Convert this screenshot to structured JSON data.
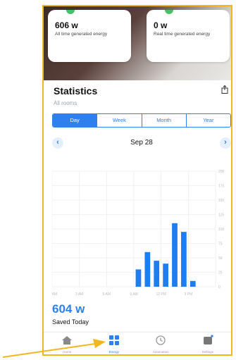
{
  "cards": [
    {
      "value": "606 w",
      "label": "All time generated energy"
    },
    {
      "value": "0 w",
      "label": "Real time generated energy"
    }
  ],
  "statistics": {
    "title": "Statistics",
    "rooms": "All rooms"
  },
  "segments": [
    "Day",
    "Week",
    "Month",
    "Year"
  ],
  "date": "Sep 28",
  "chart_data": {
    "type": "bar",
    "categories": [
      "12 AM",
      "3 AM",
      "6 AM",
      "9 AM",
      "12 PM",
      "3 PM",
      "6 PM"
    ],
    "x_tick_labels": [
      "12 AM",
      "3 AM",
      "6 AM",
      "9 AM",
      "12 PM",
      "3 PM"
    ],
    "values_by_hour": {
      "9": 30,
      "10": 60,
      "11": 45,
      "12": 40,
      "13": 110,
      "14": 95,
      "15": 10
    },
    "y_tick_labels": [
      "0",
      "25",
      "50",
      "75",
      "100",
      "125",
      "150",
      "175",
      "200"
    ],
    "ylim": [
      0,
      200
    ],
    "grid": true,
    "bar_color": "#1e7df0"
  },
  "saved": {
    "value": "604 w",
    "label": "Saved Today"
  },
  "tabs": [
    {
      "label": "Home",
      "icon": "home-icon"
    },
    {
      "label": "Energy",
      "icon": "grid-icon"
    },
    {
      "label": "Automation",
      "icon": "clock-icon"
    },
    {
      "label": "Settings",
      "icon": "settings-icon"
    }
  ],
  "accent": "#2f80ed",
  "annotation_color": "#f2b61f"
}
